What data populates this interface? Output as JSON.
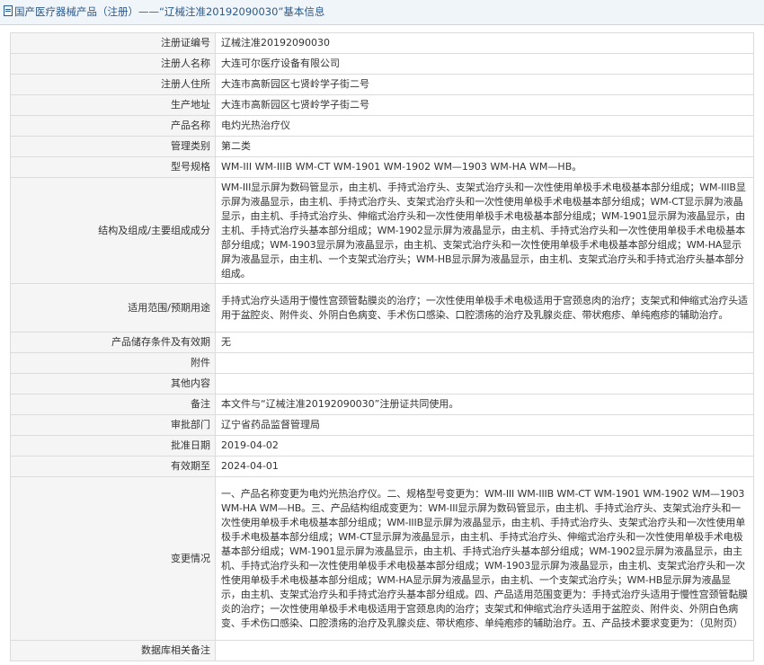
{
  "header": {
    "title": "国产医疗器械产品（注册）——“辽械注准20192090030”基本信息"
  },
  "rows": [
    {
      "label": "注册证编号",
      "value": "辽械注准20192090030"
    },
    {
      "label": "注册人名称",
      "value": "大连可尔医疗设备有限公司"
    },
    {
      "label": "注册人住所",
      "value": "大连市高新园区七贤岭学子街二号"
    },
    {
      "label": "生产地址",
      "value": "大连市高新园区七贤岭学子街二号"
    },
    {
      "label": "产品名称",
      "value": "电灼光热治疗仪"
    },
    {
      "label": "管理类别",
      "value": "第二类"
    },
    {
      "label": "型号规格",
      "value": "WM-III WM-IIIB WM-CT WM-1901 WM-1902 WM—1903 WM-HA WM—HB。"
    },
    {
      "label": "结构及组成/主要组成成分",
      "value": "WM-III显示屏为数码管显示，由主机、手持式治疗头、支架式治疗头和一次性使用单极手术电极基本部分组成；WM-IIIB显示屏为液晶显示，由主机、手持式治疗头、支架式治疗头和一次性使用单极手术电极基本部分组成；WM-CT显示屏为液晶显示，由主机、手持式治疗头、伸缩式治疗头和一次性使用单极手术电极基本部分组成；WM-1901显示屏为液晶显示，由主机、手持式治疗头基本部分组成；WM-1902显示屏为液晶显示，由主机、手持式治疗头和一次性使用单极手术电极基本部分组成；WM-1903显示屏为液晶显示，由主机、支架式治疗头和一次性使用单极手术电极基本部分组成；WM-HA显示屏为液晶显示，由主机、一个支架式治疗头；WM-HB显示屏为液晶显示，由主机、支架式治疗头和手持式治疗头基本部分组成。"
    },
    {
      "label": "适用范围/预期用途",
      "value": "手持式治疗头适用于慢性宫颈管黏膜炎的治疗；一次性使用单极手术电极适用于宫颈息肉的治疗；支架式和伸缩式治疗头适用于盆腔炎、附件炎、外阴白色病变、手术伤口感染、口腔溃疡的治疗及乳腺炎症、带状疱疹、单纯疱疹的辅助治疗。"
    },
    {
      "label": "产品储存条件及有效期",
      "value": "无"
    },
    {
      "label": "附件",
      "value": ""
    },
    {
      "label": "其他内容",
      "value": ""
    },
    {
      "label": "备注",
      "value": "本文件与“辽械注准20192090030”注册证共同使用。"
    },
    {
      "label": "审批部门",
      "value": "辽宁省药品监督管理局"
    },
    {
      "label": "批准日期",
      "value": "2019-04-02"
    },
    {
      "label": "有效期至",
      "value": "2024-04-01"
    },
    {
      "label": "变更情况",
      "value": "一、产品名称变更为电灼光热治疗仪。二、规格型号变更为：WM-III WM-IIIB WM-CT WM-1901 WM-1902 WM—1903 WM-HA WM—HB。三、产品结构组成变更为：WM-III显示屏为数码管显示，由主机、手持式治疗头、支架式治疗头和一次性使用单极手术电极基本部分组成；WM-IIIB显示屏为液晶显示，由主机、手持式治疗头、支架式治疗头和一次性使用单极手术电极基本部分组成；WM-CT显示屏为液晶显示，由主机、手持式治疗头、伸缩式治疗头和一次性使用单极手术电极基本部分组成；WM-1901显示屏为液晶显示，由主机、手持式治疗头基本部分组成；WM-1902显示屏为液晶显示，由主机、手持式治疗头和一次性使用单极手术电极基本部分组成；WM-1903显示屏为液晶显示，由主机、支架式治疗头和一次性使用单极手术电极基本部分组成；WM-HA显示屏为液晶显示，由主机、一个支架式治疗头；WM-HB显示屏为液晶显示，由主机、支架式治疗头和手持式治疗头基本部分组成。四、产品适用范围变更为：手持式治疗头适用于慢性宫颈管黏膜炎的治疗；一次性使用单极手术电极适用于宫颈息肉的治疗；支架式和伸缩式治疗头适用于盆腔炎、附件炎、外阴白色病变、手术伤口感染、口腔溃疡的治疗及乳腺炎症、带状疱疹、单纯疱疹的辅助治疗。五、产品技术要求变更为：（见附页）"
    },
    {
      "label": "数据库相关备注",
      "value": ""
    }
  ]
}
